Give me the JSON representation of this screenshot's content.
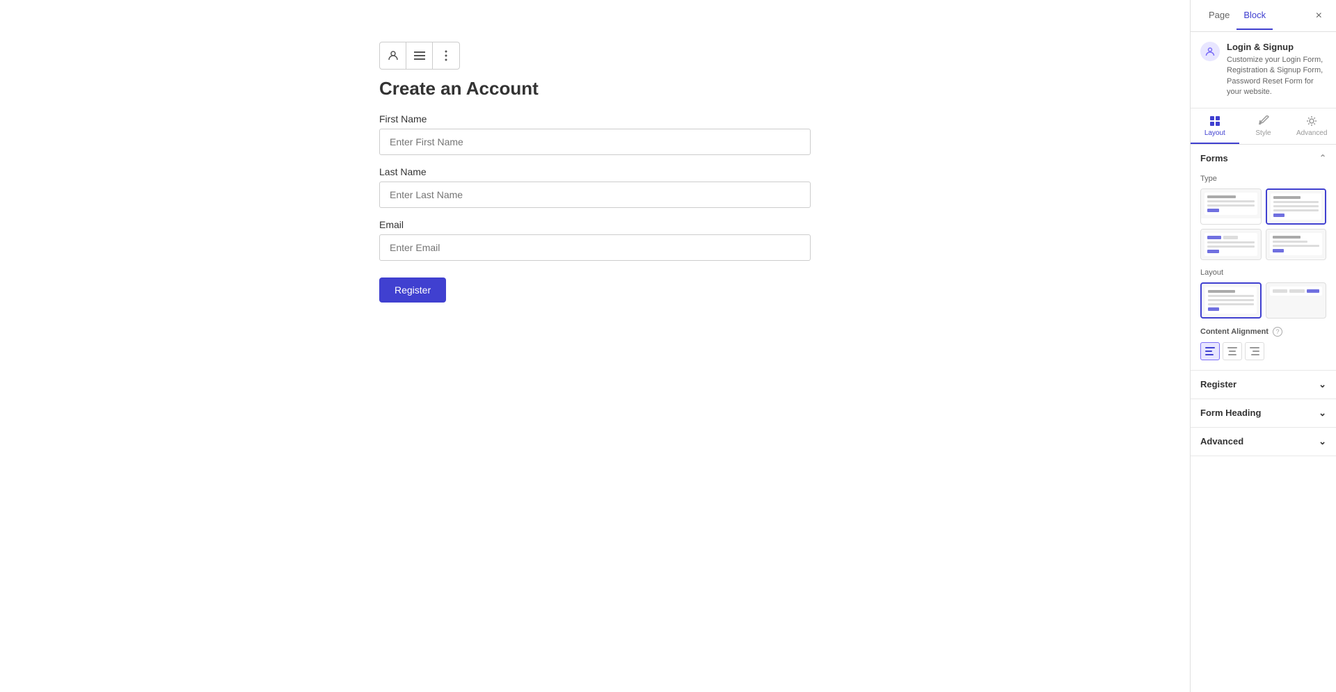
{
  "panel": {
    "tabs": [
      {
        "id": "page",
        "label": "Page",
        "active": false
      },
      {
        "id": "block",
        "label": "Block",
        "active": true
      }
    ],
    "close_label": "×"
  },
  "plugin": {
    "name": "Login & Signup",
    "description": "Customize your Login Form, Registration & Signup Form, Password Reset Form for your website.",
    "icon": "👤"
  },
  "tab_icons": [
    {
      "id": "layout",
      "label": "Layout",
      "active": true
    },
    {
      "id": "style",
      "label": "Style",
      "active": false
    },
    {
      "id": "advanced",
      "label": "Advanced",
      "active": false
    }
  ],
  "forms_section": {
    "label": "Forms",
    "type_label": "Type",
    "types": [
      {
        "id": "signin",
        "selected": false
      },
      {
        "id": "register",
        "selected": true
      },
      {
        "id": "signup",
        "selected": false
      },
      {
        "id": "reset",
        "selected": false
      }
    ],
    "layout_label": "Layout",
    "layouts": [
      {
        "id": "stacked",
        "selected": true
      },
      {
        "id": "inline",
        "selected": false
      }
    ],
    "content_alignment_label": "Content Alignment",
    "alignments": [
      {
        "id": "left",
        "symbol": "≡",
        "active": true
      },
      {
        "id": "center",
        "symbol": "≡",
        "active": false
      },
      {
        "id": "right",
        "symbol": "≡",
        "active": false
      }
    ]
  },
  "collapsed_sections": [
    {
      "id": "register",
      "label": "Register"
    },
    {
      "id": "form-heading",
      "label": "Form Heading"
    },
    {
      "id": "advanced",
      "label": "Advanced"
    }
  ],
  "canvas": {
    "form_title": "Create an Account",
    "fields": [
      {
        "id": "first-name",
        "label": "First Name",
        "placeholder": "Enter First Name"
      },
      {
        "id": "last-name",
        "label": "Last Name",
        "placeholder": "Enter Last Name"
      },
      {
        "id": "email",
        "label": "Email",
        "placeholder": "Enter Email"
      }
    ],
    "submit_button": "Register"
  },
  "toolbar": {
    "person_icon": "⊙",
    "list_icon": "≡",
    "more_icon": "⋮"
  }
}
